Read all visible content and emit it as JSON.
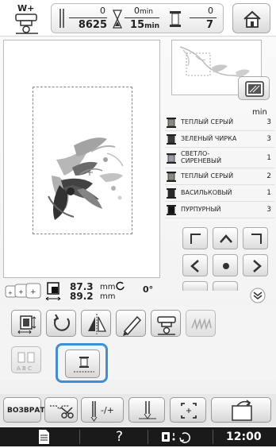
{
  "top": {
    "presser_label": "W+",
    "stitches_current": "0",
    "stitches_total": "8625",
    "time_current": "0",
    "time_total": "15",
    "time_unit": "min",
    "color_current": "0",
    "color_total": "7"
  },
  "threads": {
    "min_label": "min",
    "items": [
      {
        "name": "ТЕПЛЫЙ СЕРЫЙ",
        "min": "3",
        "color": "#8a8a80"
      },
      {
        "name": "ЗЕЛЕНЫЙ ЧИРКА",
        "min": "3",
        "color": "#3a3a3a"
      },
      {
        "name": "СВЕТЛО-\nСИРЕНЕВЫЙ",
        "min": "1",
        "color": "#9a9aa4"
      },
      {
        "name": "ТЕПЛЫЙ СЕРЫЙ",
        "min": "2",
        "color": "#8a8a80"
      },
      {
        "name": "ВАСИЛЬКОВЫЙ",
        "min": "1",
        "color": "#2a2a2a"
      },
      {
        "name": "ПУРПУРНЫЙ",
        "min": "3",
        "color": "#141414"
      }
    ]
  },
  "info": {
    "width_value": "87.3",
    "height_value": "89.2",
    "unit": "mm",
    "angle": "0°"
  },
  "tools": {
    "abc_label": "A B C"
  },
  "commands": {
    "back_label": "ВОЗВРАТ",
    "needle_label": "-/+"
  },
  "status": {
    "help": "?",
    "clock": "12:00"
  }
}
